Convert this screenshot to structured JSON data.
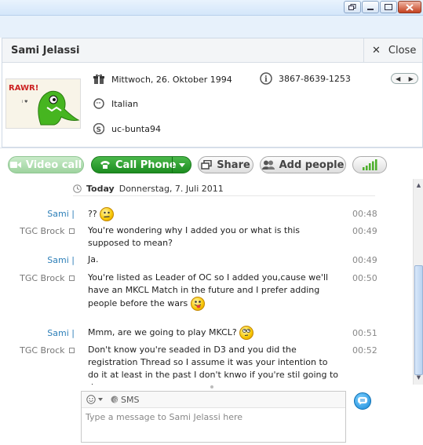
{
  "contact": {
    "name": "Sami Jelassi",
    "close_label": "Close",
    "birthday": "Mittwoch, 26. Oktober 1994",
    "phone": "3867-8639-1253",
    "language": "Italian",
    "skype_name": "uc-bunta94"
  },
  "toolbar": {
    "video_label": "Video call",
    "call_label": "Call Phone",
    "share_label": "Share",
    "add_people_label": "Add people"
  },
  "conversation": {
    "date_today": "Today",
    "date_text": "Donnerstag, 7. Juli 2011",
    "messages": [
      {
        "sender": "Sami |",
        "text": "??",
        "time": "00:48"
      },
      {
        "sender": "TGC Brock",
        "text": "You're wondering why I added you or what is this supposed to mean?",
        "time": "00:49"
      },
      {
        "sender": "Sami |",
        "text": "Ja.",
        "time": "00:49"
      },
      {
        "sender": "TGC Brock",
        "text": "You're listed as Leader of OC so I added you,cause we'll have an MKCL Match in the future and I prefer adding people before the wars",
        "time": "00:50"
      },
      {
        "sender": "Sami |",
        "text": "Mmm, are we going to play MKCL?",
        "time": "00:51"
      },
      {
        "sender": "TGC Brock",
        "text": "Don't know you're seaded in D3 and you did the registration Thread so I assume it was your intention to do it at least in the past I don't knwo if you're stil going to do",
        "time": "00:52"
      }
    ]
  },
  "compose": {
    "sms_label": "SMS",
    "placeholder": "Type a message to Sami Jelassi here"
  },
  "avatar_text": "RAWR!"
}
